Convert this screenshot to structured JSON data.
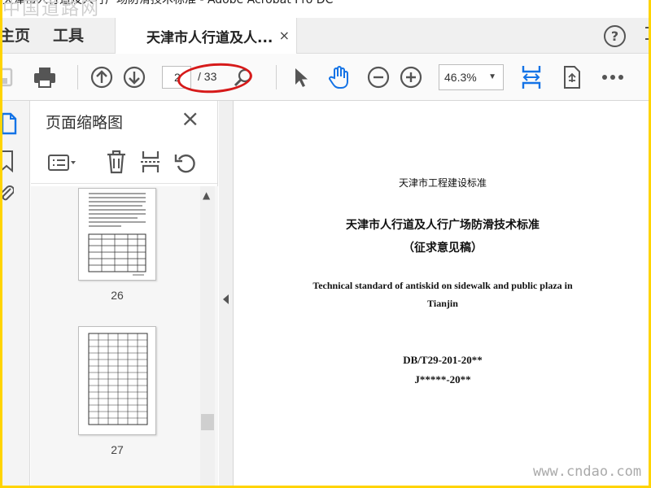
{
  "window": {
    "title": "天津市人行道及人行广场防滑技术标准 - Adobe Acrobat Pro DC",
    "watermark_top": "中国道路网",
    "watermark_bottom": "www.cndao.com"
  },
  "tabs": {
    "home": "主页",
    "tools": "工具",
    "document": "天津市人行道及人...",
    "close_glyph": "×",
    "help_glyph": "?"
  },
  "toolbar": {
    "page_current": "2",
    "page_total": "/ 33",
    "zoom": "46.3%"
  },
  "thumbnails": {
    "title": "页面缩略图",
    "close_glyph": "×",
    "pages": [
      "26",
      "27"
    ]
  },
  "document": {
    "line1": "天津市工程建设标准",
    "line2": "天津市人行道及人行广场防滑技术标准",
    "line3": "（征求意见稿）",
    "line4": "Technical standard of antiskid on sidewalk and public plaza in",
    "line5": "Tianjin",
    "line6": "DB/T29-201-20**",
    "line7": "J*****-20**"
  },
  "colors": {
    "frame_border": "#ffd400",
    "accent_blue": "#1473e6",
    "annotation_red": "#d61a1a"
  }
}
